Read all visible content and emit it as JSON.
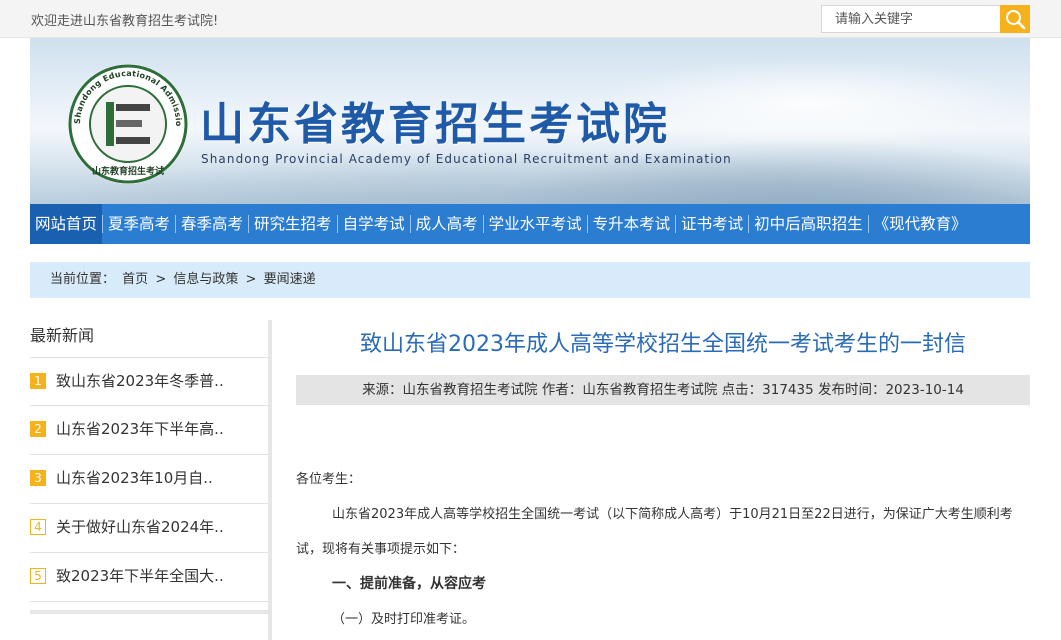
{
  "topbar": {
    "welcome": "欢迎走进山东省教育招生考试院!",
    "search_placeholder": "请输入关键字"
  },
  "banner": {
    "title": "山东省教育招生考试院",
    "subtitle": "Shandong Provincial Academy of Educational Recruitment and Examination",
    "logo_ring_text": "Shandong Educational Admission & Examinations",
    "logo_bottom_text": "山东教育招生考试"
  },
  "nav": {
    "items": [
      {
        "label": "网站首页",
        "active": true
      },
      {
        "label": "夏季高考"
      },
      {
        "label": "春季高考"
      },
      {
        "label": "研究生招考"
      },
      {
        "label": "自学考试"
      },
      {
        "label": "成人高考"
      },
      {
        "label": "学业水平考试"
      },
      {
        "label": "专升本考试"
      },
      {
        "label": "证书考试"
      },
      {
        "label": "初中后高职招生"
      },
      {
        "label": "《现代教育》"
      }
    ]
  },
  "breadcrumb": {
    "prefix": "当前位置：",
    "items": [
      "首页",
      "信息与政策",
      "要闻速递"
    ],
    "separator": ">"
  },
  "sidebar": {
    "title": "最新新闻",
    "items": [
      {
        "rank": "1",
        "text": "致山东省2023年冬季普.."
      },
      {
        "rank": "2",
        "text": "山东省2023年下半年高.."
      },
      {
        "rank": "3",
        "text": "山东省2023年10月自.."
      },
      {
        "rank": "4",
        "text": "关于做好山东省2024年.."
      },
      {
        "rank": "5",
        "text": "致2023年下半年全国大.."
      }
    ]
  },
  "article": {
    "title": "致山东省2023年成人高等学校招生全国统一考试考生的一封信",
    "meta": "来源：山东省教育招生考试院 作者：山东省教育招生考试院 点击：317435 发布时间：2023-10-14",
    "greeting": "各位考生：",
    "para1": "山东省2023年成人高等学校招生全国统一考试（以下简称成人高考）于10月21日至22日进行，为保证广大考生顺利考试，现将有关事项提示如下：",
    "heading1": "一、提前准备，从容应考",
    "sub1": "（一）及时打印准考证。"
  },
  "colors": {
    "nav": "#2a7dd1",
    "nav_active": "#1a60b0",
    "accent": "#f5b21d",
    "title_blue": "#2a6bb8",
    "breadcrumb_bg": "#d8ebfa"
  }
}
